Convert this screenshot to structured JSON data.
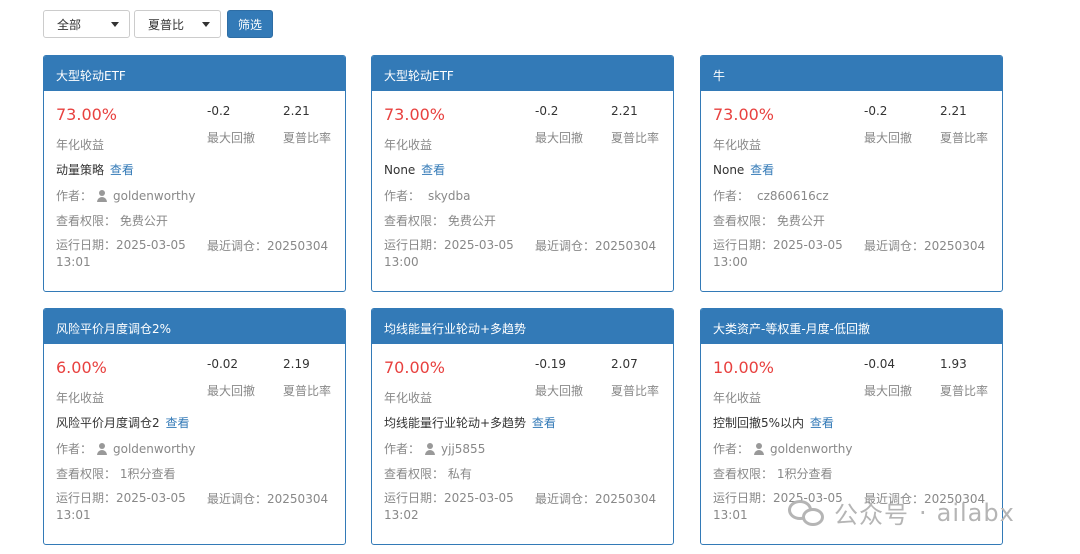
{
  "filters": {
    "category_value": "全部",
    "sort_value": "夏普比",
    "filter_button_label": "筛选"
  },
  "labels": {
    "annual_return": "年化收益",
    "max_drawdown": "最大回撤",
    "sharpe_ratio": "夏普比率",
    "view_link": "查看",
    "author_prefix": "作者：",
    "permission_prefix": "查看权限：",
    "run_date_prefix": "运行日期：",
    "rebalance_prefix": "最近调仓：",
    "user_icon": "user-icon"
  },
  "cards": [
    {
      "title": "大型轮动ETF",
      "annual_return": "73.00%",
      "max_drawdown": "-0.2",
      "sharpe": "2.21",
      "strategy": "动量策略",
      "author": "goldenworthy",
      "author_has_icon": true,
      "permission": "免费公开",
      "run_date": "2025-03-05",
      "run_time": "13:01",
      "last_rebalance": "20250304"
    },
    {
      "title": "大型轮动ETF",
      "annual_return": "73.00%",
      "max_drawdown": "-0.2",
      "sharpe": "2.21",
      "strategy": "None",
      "author": "skydba",
      "author_has_icon": false,
      "permission": "免费公开",
      "run_date": "2025-03-05",
      "run_time": "13:00",
      "last_rebalance": "20250304"
    },
    {
      "title": "牛",
      "annual_return": "73.00%",
      "max_drawdown": "-0.2",
      "sharpe": "2.21",
      "strategy": "None",
      "author": "cz860616cz",
      "author_has_icon": false,
      "permission": "免费公开",
      "run_date": "2025-03-05",
      "run_time": "13:00",
      "last_rebalance": "20250304"
    },
    {
      "title": "风险平价月度调仓2%",
      "annual_return": "6.00%",
      "max_drawdown": "-0.02",
      "sharpe": "2.19",
      "strategy": "风险平价月度调仓2",
      "author": "goldenworthy",
      "author_has_icon": true,
      "permission": "1积分查看",
      "run_date": "2025-03-05",
      "run_time": "13:01",
      "last_rebalance": "20250304"
    },
    {
      "title": "均线能量行业轮动+多趋势",
      "annual_return": "70.00%",
      "max_drawdown": "-0.19",
      "sharpe": "2.07",
      "strategy": "均线能量行业轮动+多趋势",
      "author": "yjj5855",
      "author_has_icon": true,
      "permission": "私有",
      "run_date": "2025-03-05",
      "run_time": "13:02",
      "last_rebalance": "20250304"
    },
    {
      "title": "大类资产-等权重-月度-低回撤",
      "annual_return": "10.00%",
      "max_drawdown": "-0.04",
      "sharpe": "1.93",
      "strategy": "控制回撤5%以内",
      "author": "goldenworthy",
      "author_has_icon": true,
      "permission": "1积分查看",
      "run_date": "2025-03-05",
      "run_time": "13:01",
      "last_rebalance": "20250304"
    }
  ],
  "watermark": {
    "text": "公众号",
    "separator": "·",
    "handle": "ailabx",
    "logo_icon": "wechat-logo-icon"
  },
  "colors": {
    "accent": "#337ab7",
    "return_red": "#e8413f",
    "muted": "#888888"
  }
}
